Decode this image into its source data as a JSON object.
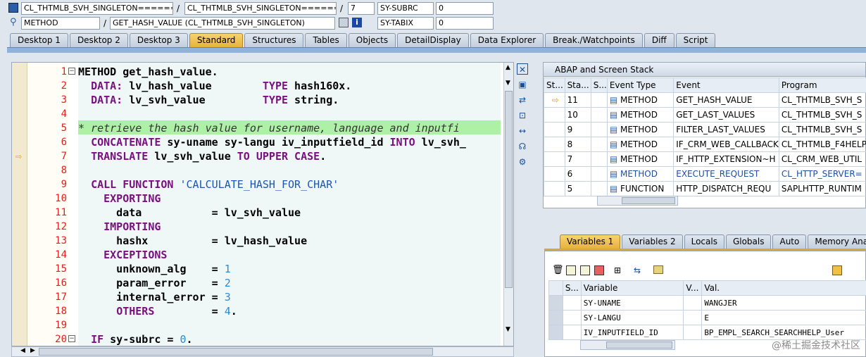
{
  "top_bar": {
    "row1": {
      "field1": "CL_THTMLB_SVH_SINGLETON=======",
      "sep1": "/",
      "field2": "CL_THTMLB_SVH_SINGLETON======",
      "sep2": "/",
      "field3": "7",
      "field4": "SY-SUBRC",
      "field5": "0"
    },
    "row2": {
      "field1": "METHOD",
      "sep1": "/",
      "field2": "GET_HASH_VALUE (CL_THTMLB_SVH_SINGLETON)",
      "field4": "SY-TABIX",
      "field5": "0"
    }
  },
  "tabs": [
    "Desktop 1",
    "Desktop 2",
    "Desktop 3",
    "Standard",
    "Structures",
    "Tables",
    "Objects",
    "DetailDisplay",
    "Data Explorer",
    "Break./Watchpoints",
    "Diff",
    "Script"
  ],
  "active_tab": "Standard",
  "editor": {
    "line_numbers": [
      "1",
      "2",
      "3",
      "4",
      "5",
      "6",
      "7",
      "8",
      "9",
      "10",
      "11",
      "12",
      "13",
      "14",
      "15",
      "16",
      "17",
      "18",
      "19",
      "20"
    ],
    "lines": [
      [
        {
          "t": "METHOD",
          "c": "kw0"
        },
        {
          "t": " get_hash_value.",
          "c": "b"
        }
      ],
      [
        {
          "t": "  ",
          "c": ""
        },
        {
          "t": "DATA:",
          "c": "kw"
        },
        {
          "t": " lv_hash_value        ",
          "c": "b"
        },
        {
          "t": "TYPE",
          "c": "kw"
        },
        {
          "t": " hash160x.",
          "c": "b"
        }
      ],
      [
        {
          "t": "  ",
          "c": ""
        },
        {
          "t": "DATA:",
          "c": "kw"
        },
        {
          "t": " lv_svh_value         ",
          "c": "b"
        },
        {
          "t": "TYPE",
          "c": "kw"
        },
        {
          "t": " string.",
          "c": "b"
        }
      ],
      [
        {
          "t": "",
          "c": ""
        }
      ],
      [
        {
          "t": "* retrieve the hash value for username, language and inputfi",
          "c": "cm"
        }
      ],
      [
        {
          "t": "  ",
          "c": ""
        },
        {
          "t": "CONCATENATE",
          "c": "kw"
        },
        {
          "t": " sy-uname sy-langu iv_inputfield_id ",
          "c": "b"
        },
        {
          "t": "INTO",
          "c": "kw"
        },
        {
          "t": " lv_svh_",
          "c": "b"
        }
      ],
      [
        {
          "t": "  ",
          "c": ""
        },
        {
          "t": "TRANSLATE",
          "c": "kw"
        },
        {
          "t": " lv_svh_value ",
          "c": "b"
        },
        {
          "t": "TO UPPER CASE",
          "c": "kw"
        },
        {
          "t": ".",
          "c": "b"
        }
      ],
      [
        {
          "t": "",
          "c": ""
        }
      ],
      [
        {
          "t": "  ",
          "c": ""
        },
        {
          "t": "CALL FUNCTION",
          "c": "kw"
        },
        {
          "t": " ",
          "c": ""
        },
        {
          "t": "'CALCULATE_HASH_FOR_CHAR'",
          "c": "str"
        }
      ],
      [
        {
          "t": "    ",
          "c": ""
        },
        {
          "t": "EXPORTING",
          "c": "kw"
        }
      ],
      [
        {
          "t": "      data           = lv_svh_value",
          "c": "b"
        }
      ],
      [
        {
          "t": "    ",
          "c": ""
        },
        {
          "t": "IMPORTING",
          "c": "kw"
        }
      ],
      [
        {
          "t": "      hashx          = lv_hash_value",
          "c": "b"
        }
      ],
      [
        {
          "t": "    ",
          "c": ""
        },
        {
          "t": "EXCEPTIONS",
          "c": "kw"
        }
      ],
      [
        {
          "t": "      unknown_alg    = ",
          "c": "b"
        },
        {
          "t": "1",
          "c": "num"
        }
      ],
      [
        {
          "t": "      param_error    = ",
          "c": "b"
        },
        {
          "t": "2",
          "c": "num"
        }
      ],
      [
        {
          "t": "      internal_error = ",
          "c": "b"
        },
        {
          "t": "3",
          "c": "num"
        }
      ],
      [
        {
          "t": "      ",
          "c": ""
        },
        {
          "t": "OTHERS",
          "c": "kw"
        },
        {
          "t": "         = ",
          "c": "b"
        },
        {
          "t": "4",
          "c": "num"
        },
        {
          "t": ".",
          "c": "b"
        }
      ],
      [
        {
          "t": "",
          "c": ""
        }
      ],
      [
        {
          "t": "  ",
          "c": ""
        },
        {
          "t": "IF",
          "c": "kw"
        },
        {
          "t": " sy-subrc = ",
          "c": "b"
        },
        {
          "t": "0",
          "c": "num"
        },
        {
          "t": ".",
          "c": "b"
        }
      ]
    ]
  },
  "stack_panel": {
    "title": "ABAP and Screen Stack",
    "headers": [
      "St...",
      "Sta...",
      "S...",
      "Event Type",
      "Event",
      "Program"
    ],
    "rows": [
      {
        "stack": "11",
        "type": "METHOD",
        "event": "GET_HASH_VALUE",
        "program": "CL_THTMLB_SVH_S"
      },
      {
        "stack": "10",
        "type": "METHOD",
        "event": "GET_LAST_VALUES",
        "program": "CL_THTMLB_SVH_S"
      },
      {
        "stack": "9",
        "type": "METHOD",
        "event": "FILTER_LAST_VALUES",
        "program": "CL_THTMLB_SVH_S"
      },
      {
        "stack": "8",
        "type": "METHOD",
        "event": "IF_CRM_WEB_CALLBACK",
        "program": "CL_THTMLB_F4HELP"
      },
      {
        "stack": "7",
        "type": "METHOD",
        "event": "IF_HTTP_EXTENSION~H",
        "program": "CL_CRM_WEB_UTIL"
      },
      {
        "stack": "6",
        "type": "METHOD",
        "event": "EXECUTE_REQUEST",
        "program": "CL_HTTP_SERVER="
      },
      {
        "stack": "5",
        "type": "FUNCTION",
        "event": "HTTP_DISPATCH_REQU",
        "program": "SAPLHTTP_RUNTIM"
      }
    ]
  },
  "var_tabs": [
    "Variables 1",
    "Variables 2",
    "Locals",
    "Globals",
    "Auto",
    "Memory Anal"
  ],
  "var_panel": {
    "headers": [
      "S...",
      "Variable",
      "V...",
      "Val."
    ],
    "rows": [
      {
        "variable": "SY-UNAME",
        "value": "WANGJER"
      },
      {
        "variable": "SY-LANGU",
        "value": "E"
      },
      {
        "variable": "IV_INPUTFIELD_ID",
        "value": "BP_EMPL_SEARCH_SEARCHHELP_User"
      }
    ]
  },
  "watermark": "@稀土掘金技术社区"
}
